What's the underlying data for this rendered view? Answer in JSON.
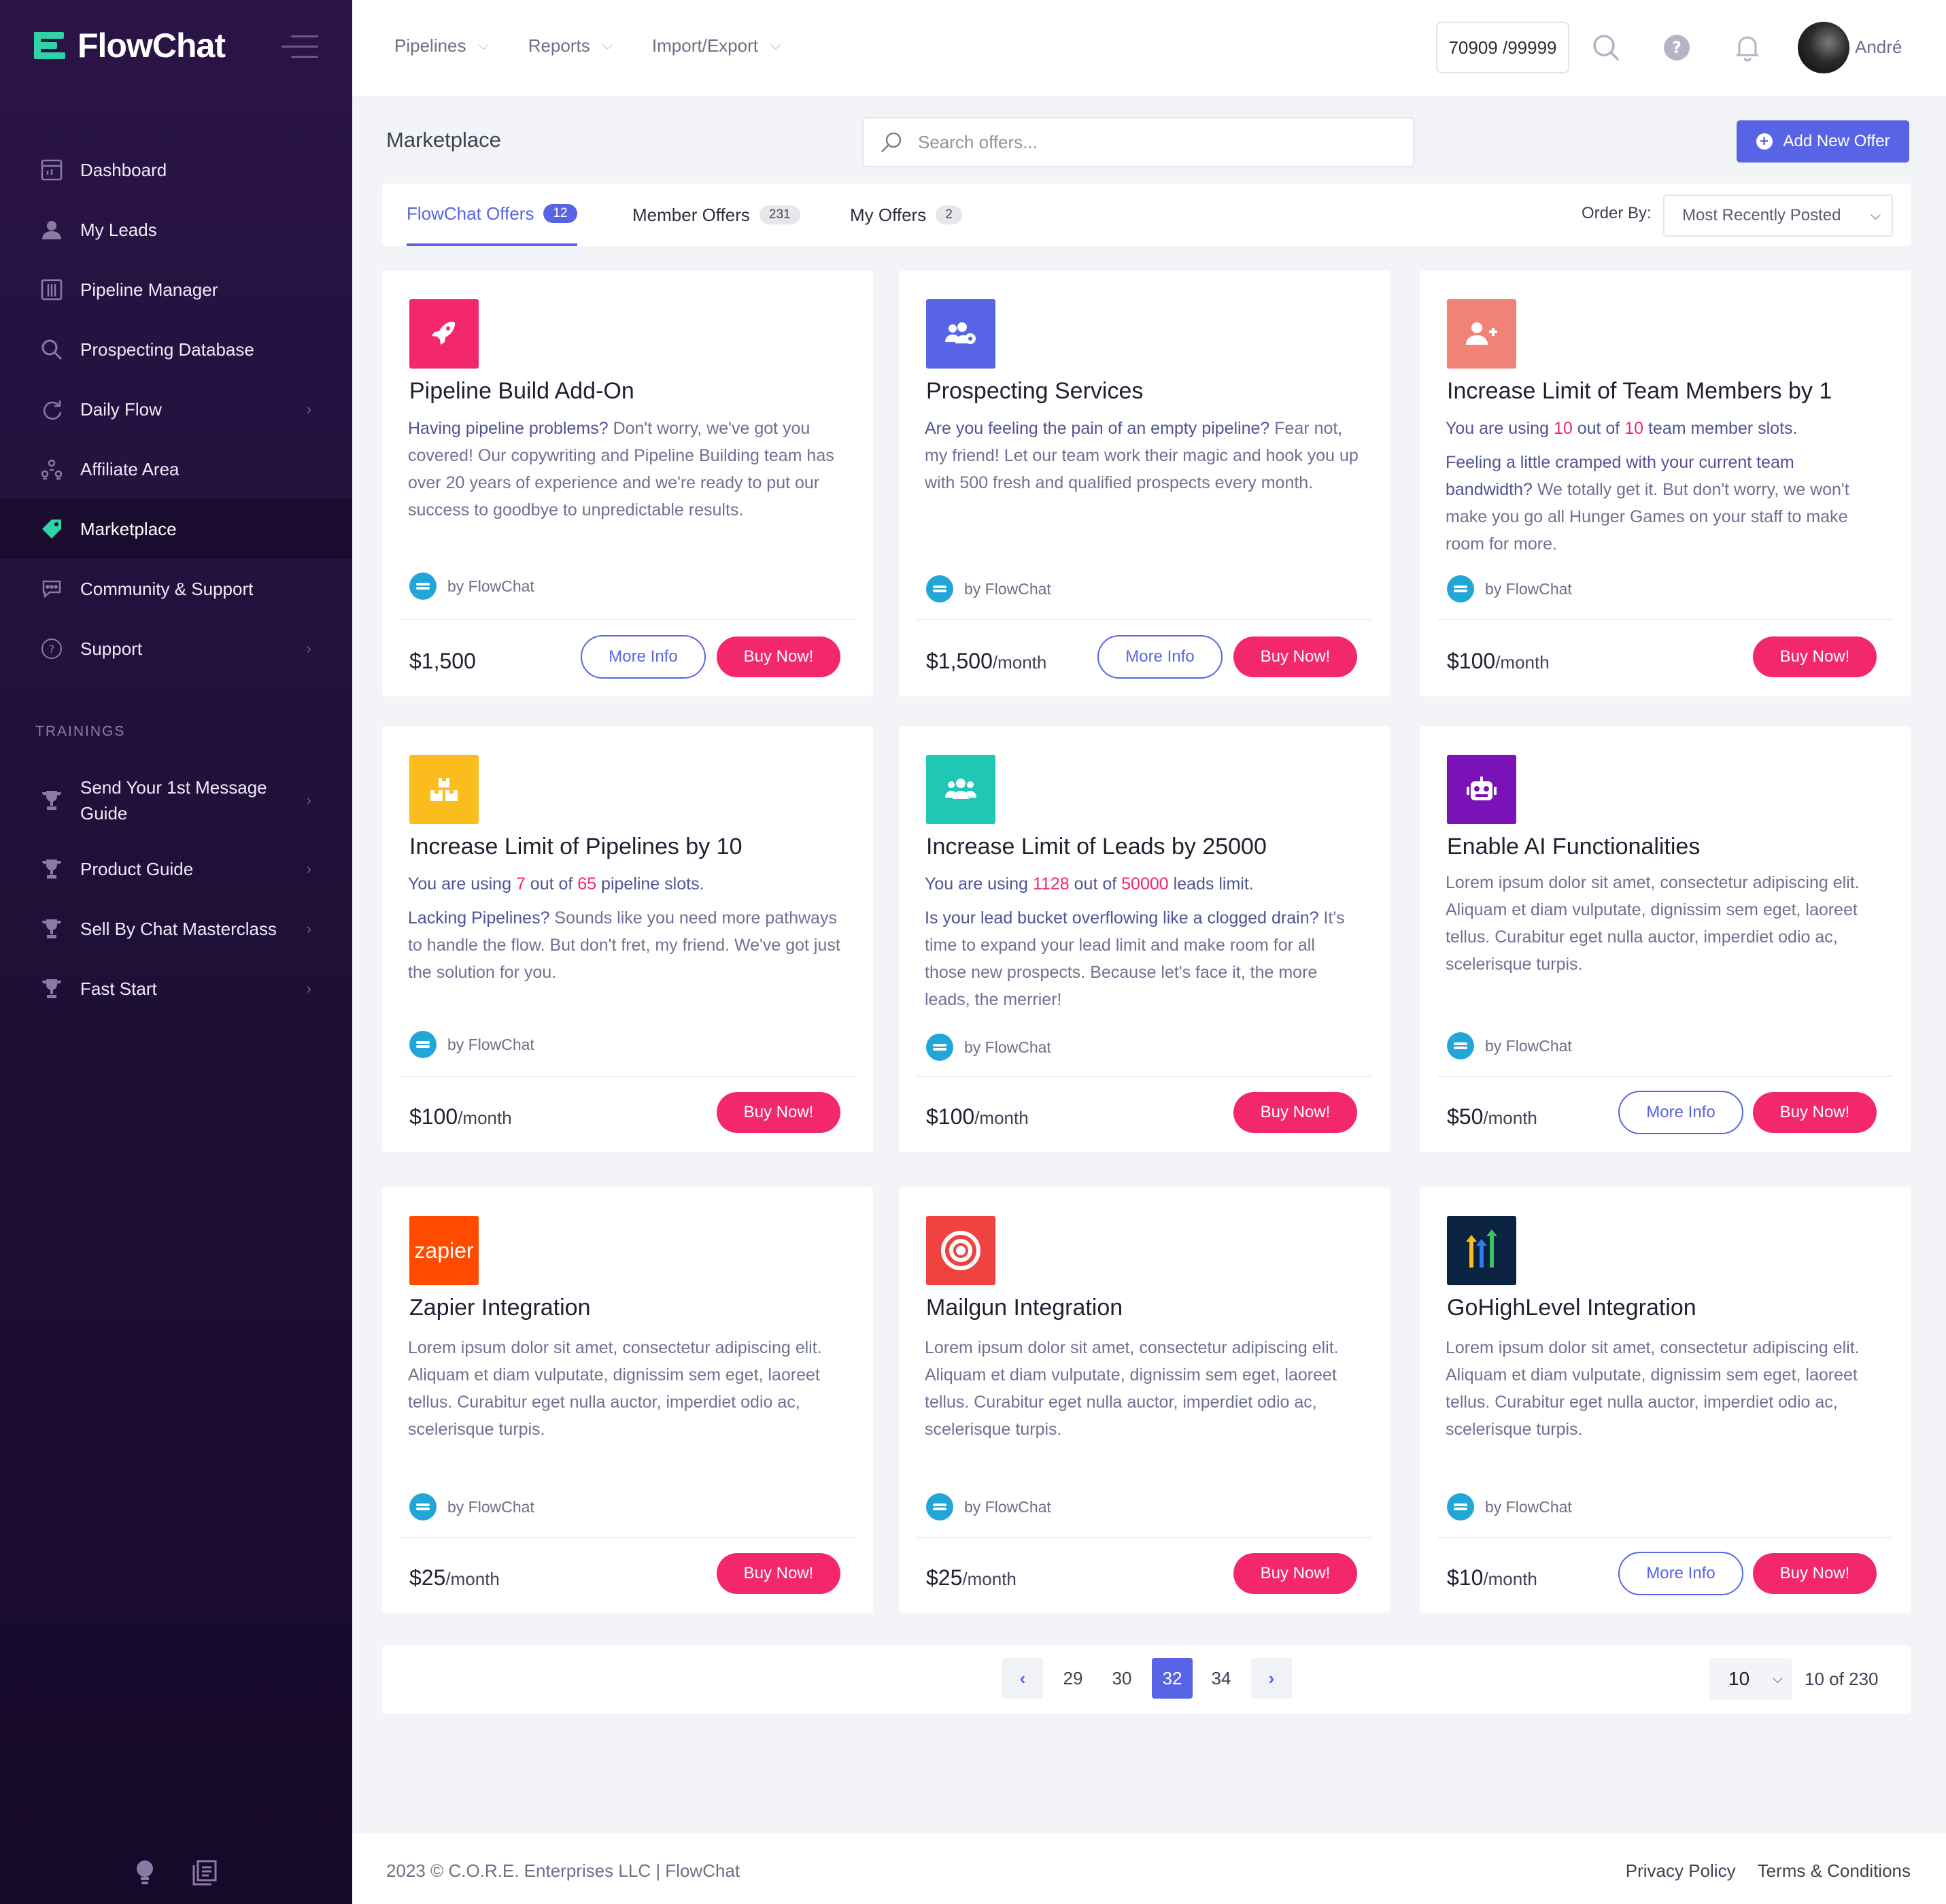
{
  "app": {
    "name": "FlowChat"
  },
  "sidebar": {
    "items": [
      {
        "label": "Dashboard",
        "icon": "dashboard-icon"
      },
      {
        "label": "My Leads",
        "icon": "user-icon"
      },
      {
        "label": "Pipeline Manager",
        "icon": "columns-icon"
      },
      {
        "label": "Prospecting Database",
        "icon": "search-icon"
      },
      {
        "label": "Daily Flow",
        "icon": "refresh-icon"
      },
      {
        "label": "Affiliate Area",
        "icon": "network-icon"
      },
      {
        "label": "Marketplace",
        "icon": "tag-icon",
        "active": true
      },
      {
        "label": "Community & Support",
        "icon": "chat-icon"
      },
      {
        "label": "Support",
        "icon": "question-icon"
      }
    ],
    "trainings_title": "TRAININGS",
    "trainings": [
      {
        "label_1": "Send Your 1st Message",
        "label_2": "Guide"
      },
      {
        "label": "Product Guide"
      },
      {
        "label": "Sell By Chat Masterclass"
      },
      {
        "label": "Fast Start"
      }
    ]
  },
  "topbar": {
    "nav": [
      "Pipelines",
      "Reports",
      "Import/Export"
    ],
    "counter": "70909 /99999",
    "user_name": "André"
  },
  "page": {
    "title": "Marketplace",
    "search_placeholder": "Search offers...",
    "add_button": "Add New Offer"
  },
  "tabs": [
    {
      "label": "FlowChat Offers",
      "count": "12"
    },
    {
      "label": "Member Offers",
      "count": "231"
    },
    {
      "label": "My Offers",
      "count": "2"
    }
  ],
  "order_by": {
    "label": "Order By:",
    "value": "Most Recently Posted"
  },
  "cards": [
    {
      "title": "Pipeline Build Add-On",
      "desc_lead": "Having pipeline problems?",
      "desc": " Don't worry, we've got you covered! Our copywriting and Pipeline Building team has over 20 years of experience and we're ready to put our success to goodbye to unpredictable results.",
      "by": "by FlowChat",
      "price": "$1,500",
      "period": "",
      "more_info": "More Info",
      "buy": "Buy Now!"
    },
    {
      "title": "Prospecting Services",
      "desc_lead": "Are you feeling the pain of an empty pipeline?",
      "desc": " Fear not, my friend! Let our team work their magic and hook you up with 500 fresh and qualified prospects every month.",
      "by": "by FlowChat",
      "price": "$1,500",
      "period": "/month",
      "more_info": "More Info",
      "buy": "Buy Now!"
    },
    {
      "title": "Increase Limit of Team Members by 1",
      "usage": {
        "pre": "You are using ",
        "used": "10",
        "mid": " out of ",
        "limit": "10",
        "post": " team member slots."
      },
      "desc_lead": "Feeling a little cramped with your current team bandwidth?",
      "desc": " We totally get it. But don't worry, we won't make you go all Hunger Games on your staff to make room for more.",
      "by": "by FlowChat",
      "price": "$100",
      "period": "/month",
      "buy": "Buy Now!"
    },
    {
      "title": "Increase Limit of Pipelines by 10",
      "usage": {
        "pre": "You are using ",
        "used": "7",
        "mid": " out of ",
        "limit": "65",
        "post": " pipeline slots."
      },
      "desc_lead": "Lacking Pipelines?",
      "desc": " Sounds like you need more pathways to handle the flow. But don't fret, my friend. We've got just the solution for you.",
      "by": "by FlowChat",
      "price": "$100",
      "period": "/month",
      "buy": "Buy Now!"
    },
    {
      "title": "Increase Limit of Leads by 25000",
      "usage": {
        "pre": "You are using ",
        "used": "1128",
        "mid": " out of ",
        "limit": "50000",
        "post": " leads limit."
      },
      "desc_lead": "Is your lead bucket overflowing like a clogged drain?",
      "desc": " It's time to expand your lead limit and make room for all those new prospects. Because let's face it, the more leads, the merrier!",
      "by": "by FlowChat",
      "price": "$100",
      "period": "/month",
      "buy": "Buy Now!"
    },
    {
      "title": "Enable AI Functionalities",
      "desc": "Lorem ipsum dolor sit amet, consectetur adipiscing elit. Aliquam et diam vulputate, dignissim sem eget, laoreet tellus. Curabitur eget nulla auctor, imperdiet odio ac, scelerisque turpis.",
      "by": "by FlowChat",
      "price": "$50",
      "period": "/month",
      "more_info": "More Info",
      "buy": "Buy Now!"
    },
    {
      "title": "Zapier Integration",
      "logo_text": "zapier",
      "desc": "Lorem ipsum dolor sit amet, consectetur adipiscing elit. Aliquam et diam vulputate, dignissim sem eget, laoreet tellus. Curabitur eget nulla auctor, imperdiet odio ac, scelerisque turpis.",
      "by": "by FlowChat",
      "price": "$25",
      "period": "/month",
      "buy": "Buy Now!"
    },
    {
      "title": "Mailgun Integration",
      "desc": "Lorem ipsum dolor sit amet, consectetur adipiscing elit. Aliquam et diam vulputate, dignissim sem eget, laoreet tellus. Curabitur eget nulla auctor, imperdiet odio ac, scelerisque turpis.",
      "by": "by FlowChat",
      "price": "$25",
      "period": "/month",
      "buy": "Buy Now!"
    },
    {
      "title": "GoHighLevel Integration",
      "desc": "Lorem ipsum dolor sit amet, consectetur adipiscing elit. Aliquam et diam vulputate, dignissim sem eget, laoreet tellus. Curabitur eget nulla auctor, imperdiet odio ac, scelerisque turpis.",
      "by": "by FlowChat",
      "price": "$10",
      "period": "/month",
      "more_info": "More Info",
      "buy": "Buy Now!"
    }
  ],
  "pagination": {
    "pages": [
      "29",
      "30",
      "32",
      "34"
    ],
    "current": "32",
    "per_page": "10",
    "total": "10 of 230"
  },
  "footer": {
    "copyright": "2023 © C.O.R.E. Enterprises LLC | FlowChat",
    "links": [
      "Privacy Policy",
      "Terms & Conditions"
    ]
  },
  "colors": {
    "accent": "#5864e6",
    "buy": "#f3286c",
    "sidebar_bg": "#241240",
    "brand_green": "#2fd3a7"
  }
}
